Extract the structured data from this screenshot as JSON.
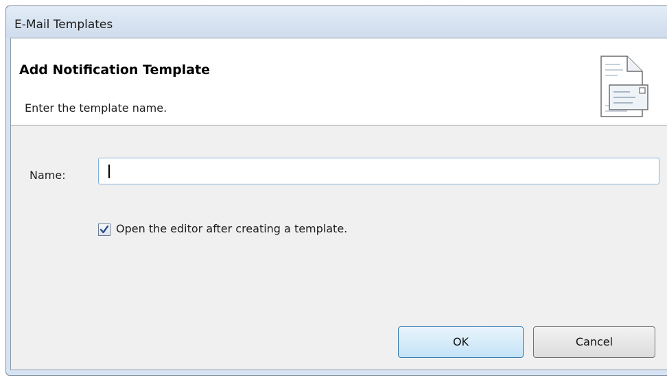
{
  "window": {
    "title": "E-Mail Templates"
  },
  "banner": {
    "title": "Add Notification Template",
    "subtitle": "Enter the template name.",
    "icon": "email-template-icon"
  },
  "form": {
    "name_label": "Name:",
    "name_value": "",
    "open_editor_checked": true,
    "open_editor_label": "Open the editor after creating a template."
  },
  "buttons": {
    "ok_label": "OK",
    "cancel_label": "Cancel"
  },
  "colors": {
    "title_bar": "#d6e3f2",
    "default_button_border": "#3c7fb1",
    "focused_input_border": "#7fb0d9",
    "checkmark": "#2a4f8c"
  }
}
